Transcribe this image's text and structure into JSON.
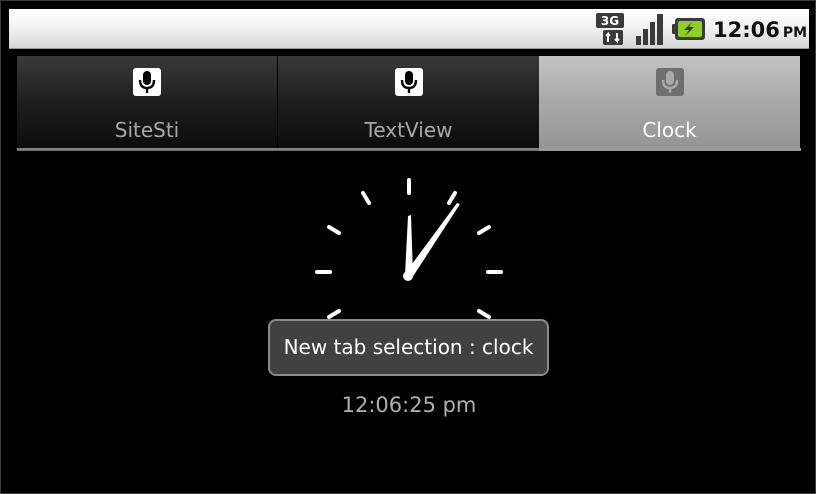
{
  "status_bar": {
    "network": "3G",
    "time": "12:06",
    "ampm": "PM"
  },
  "tabs": [
    {
      "label": "SiteSti",
      "icon": "microphone-icon",
      "selected": false
    },
    {
      "label": "TextView",
      "icon": "microphone-icon",
      "selected": false
    },
    {
      "label": "Clock",
      "icon": "microphone-icon",
      "selected": true
    }
  ],
  "clock": {
    "analog_time": "12:06",
    "digital_time": "12:06:25 pm"
  },
  "toast": {
    "message": "New tab selection : clock"
  }
}
